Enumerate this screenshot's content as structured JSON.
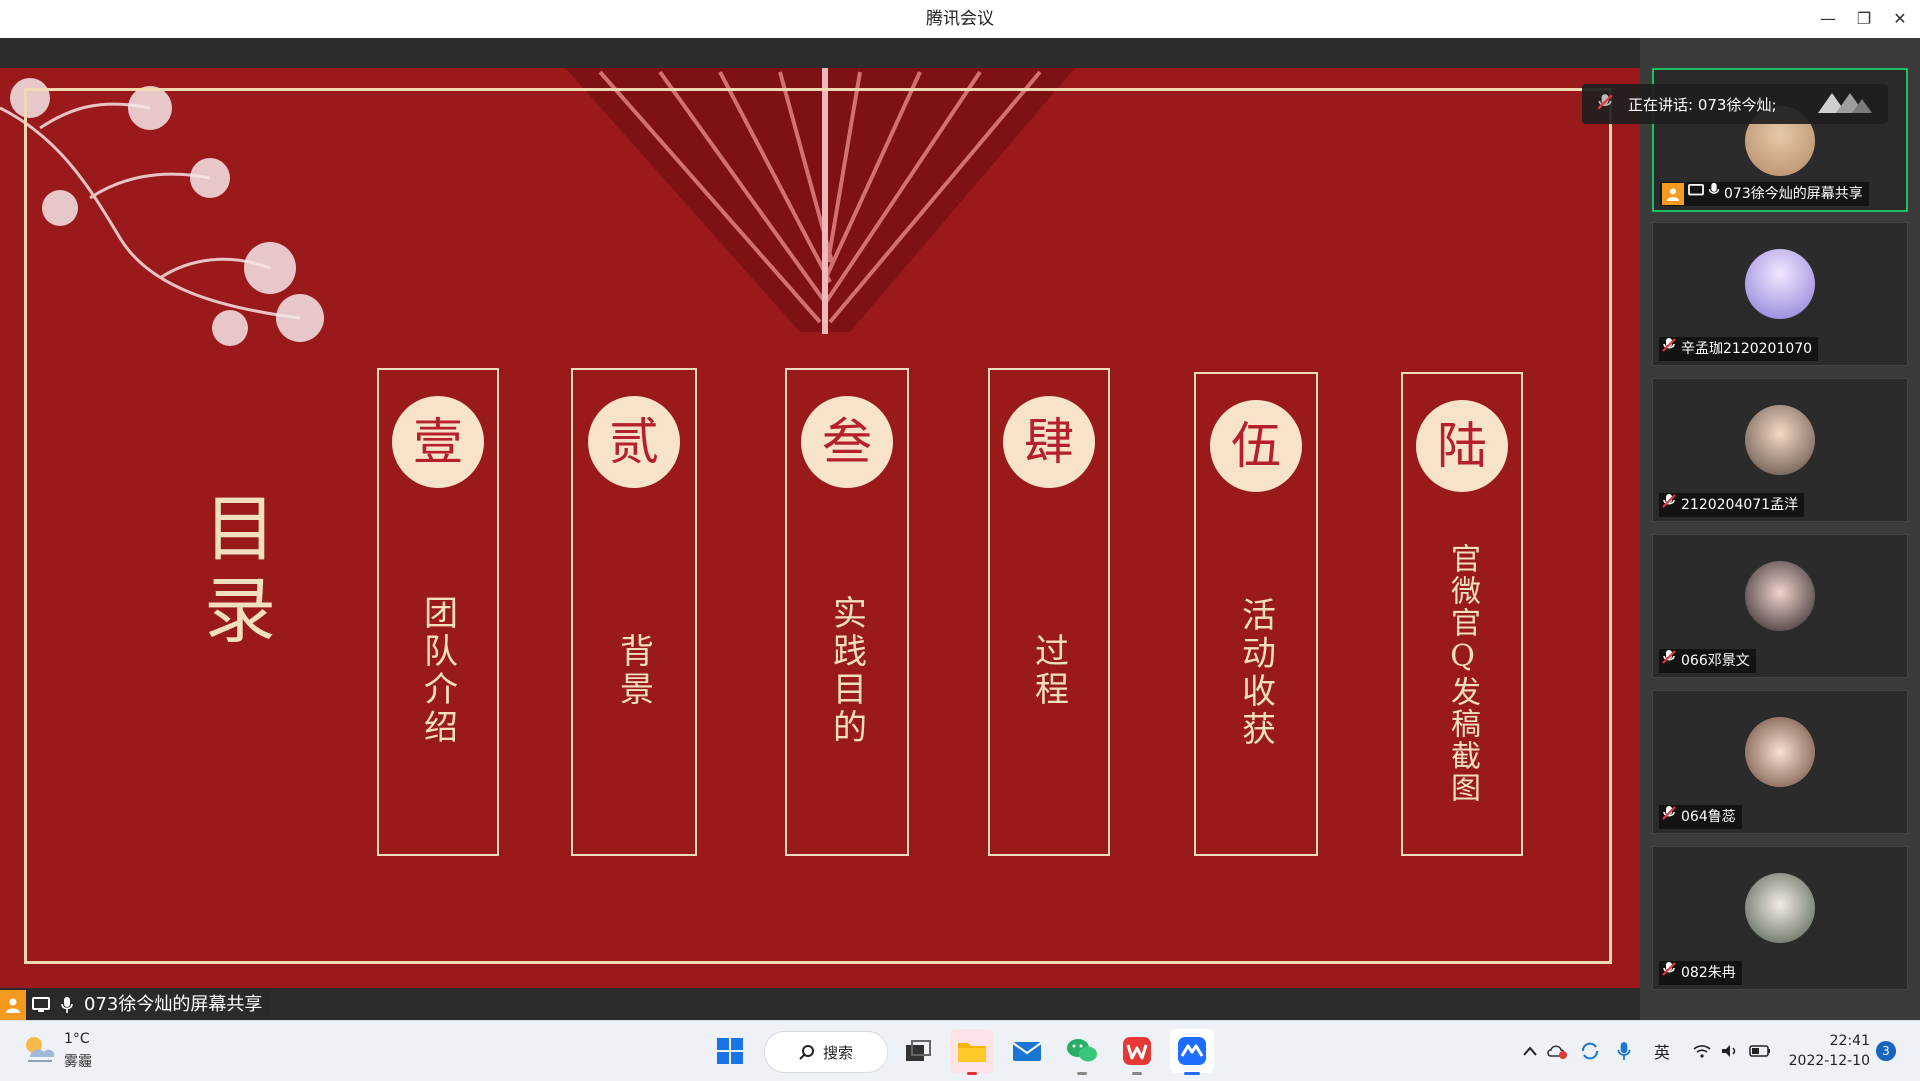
{
  "window": {
    "title": "腾讯会议",
    "controls": {
      "minimize": "—",
      "restore": "❐",
      "close": "✕"
    }
  },
  "slide": {
    "toc_title": "目录",
    "items": [
      {
        "badge": "壹",
        "label": "团队介绍"
      },
      {
        "badge": "贰",
        "label": "背景"
      },
      {
        "badge": "叁",
        "label": "实践目的"
      },
      {
        "badge": "肆",
        "label": "过程"
      },
      {
        "badge": "伍",
        "label": "活动收获"
      },
      {
        "badge": "陆",
        "label": "官微官Q发稿截图"
      }
    ],
    "colors": {
      "background": "#9a1a1c",
      "accent": "#f2dfc0",
      "badge": "#f6e3c8"
    }
  },
  "share_caption": "073徐今灿的屏幕共享",
  "speaking_banner": "正在讲话: 073徐今灿;",
  "participants": [
    {
      "name": "073徐今灿的屏幕共享",
      "active": true
    },
    {
      "name": "辛孟珈2120201070",
      "active": false
    },
    {
      "name": "2120204071孟洋",
      "active": false
    },
    {
      "name": "066邓景文",
      "active": false
    },
    {
      "name": "064鲁蕊",
      "active": false
    },
    {
      "name": "082朱冉",
      "active": false
    }
  ],
  "taskbar": {
    "weather": {
      "temp": "1°C",
      "condition": "雾霾"
    },
    "search_label": "搜索",
    "tray": {
      "ime": "英"
    },
    "clock": {
      "time": "22:41",
      "date": "2022-12-10"
    },
    "notification_count": "3"
  }
}
